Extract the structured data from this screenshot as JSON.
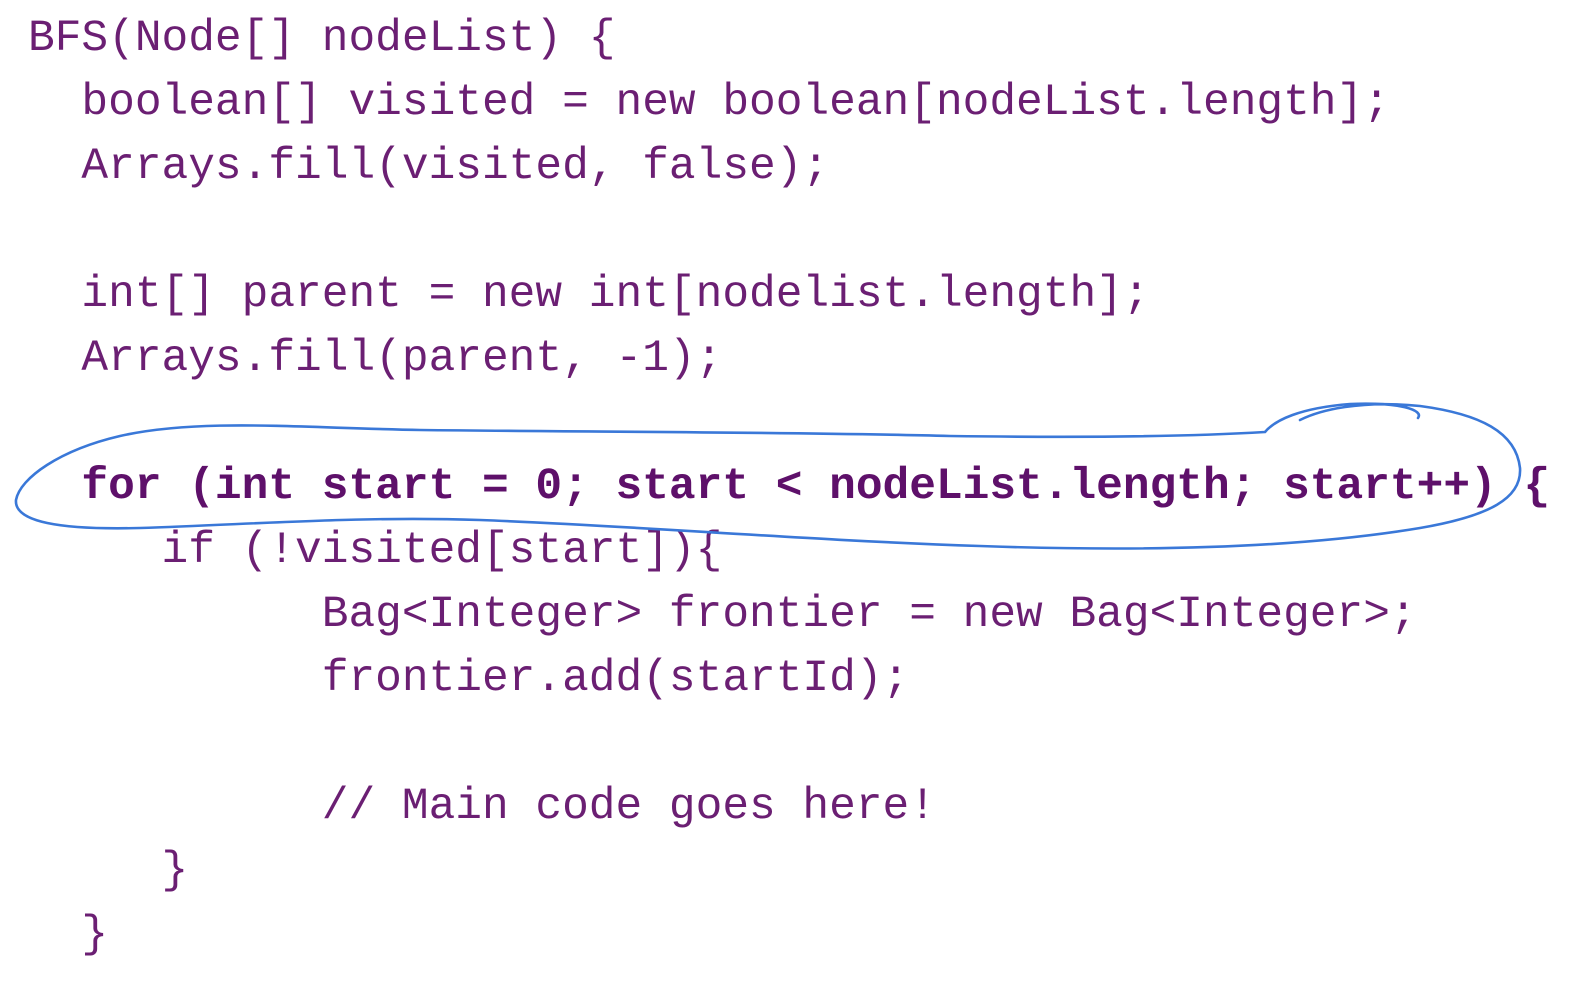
{
  "code": {
    "lines": [
      "BFS(Node[] nodeList) {",
      "  boolean[] visited = new boolean[nodeList.length];",
      "  Arrays.fill(visited, false);",
      "",
      "  int[] parent = new int[nodelist.length];",
      "  Arrays.fill(parent, -1);",
      "",
      "  for (int start = 0; start < nodeList.length; start++) {",
      "     if (!visited[start]){",
      "           Bag<Integer> frontier = new Bag<Integer>;",
      "           frontier.add(startId);",
      "",
      "           // Main code goes here!",
      "     }",
      "  }"
    ],
    "highlight_line": 7
  },
  "colors": {
    "code_text": "#6b1f73",
    "highlight_text": "#5e106a",
    "annotation_ink": "#3a78d8",
    "background": "#ffffff"
  }
}
